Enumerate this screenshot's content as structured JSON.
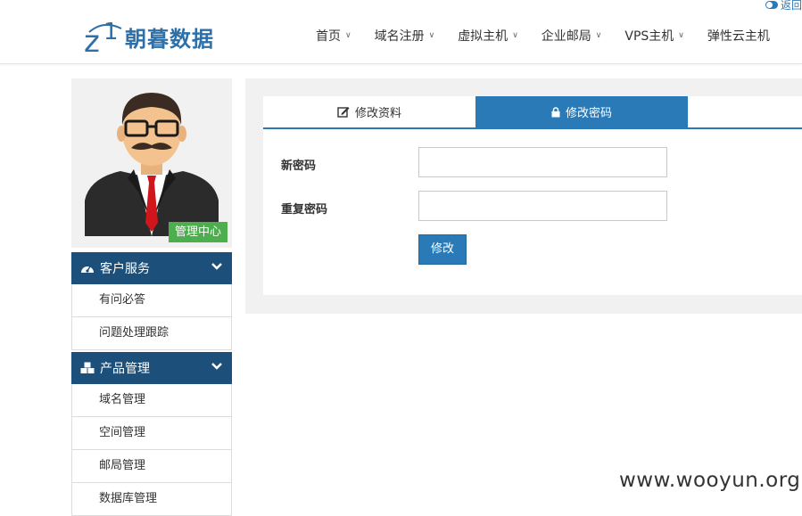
{
  "header": {
    "back_label": "返回",
    "logo_text": "朝暮数据",
    "nav": [
      "首页",
      "域名注册",
      "虚拟主机",
      "企业邮局",
      "VPS主机",
      "弹性云主机"
    ]
  },
  "profile": {
    "badge": "管理中心"
  },
  "sidebar": {
    "groups": [
      {
        "title": "客户服务",
        "icon": "dashboard-icon",
        "items": [
          "有问必答",
          "问题处理跟踪"
        ]
      },
      {
        "title": "产品管理",
        "icon": "cubes-icon",
        "items": [
          "域名管理",
          "空间管理",
          "邮局管理",
          "数据库管理"
        ]
      }
    ]
  },
  "tabs": {
    "edit_profile": {
      "label": "修改资料",
      "icon": "edit-icon"
    },
    "change_password": {
      "label": "修改密码",
      "icon": "lock-icon"
    }
  },
  "form": {
    "new_password_label": "新密码",
    "new_password_value": "",
    "repeat_password_label": "重复密码",
    "repeat_password_value": "",
    "submit_label": "修改"
  },
  "watermark": "www.wooyun.org",
  "colors": {
    "primary": "#2a7ab8",
    "sidebar_head": "#1c4f7a",
    "badge": "#4cae4c"
  }
}
